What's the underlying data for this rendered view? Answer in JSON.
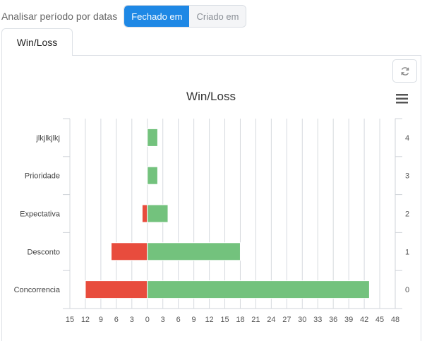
{
  "filter": {
    "label": "Analisar período por datas",
    "options": [
      "Fechado em",
      "Criado em"
    ],
    "selected": "Fechado em"
  },
  "tabs": [
    {
      "label": "Win/Loss",
      "active": true
    }
  ],
  "toolbar": {
    "refresh_icon": "refresh-icon",
    "menu_icon": "hamburger-menu-icon"
  },
  "colors": {
    "loss": "#e84c3d",
    "win": "#73c27d",
    "accent": "#1e88e5"
  },
  "chart_data": {
    "type": "bar",
    "orientation": "horizontal",
    "stacking": "diverging",
    "title": "Win/Loss",
    "categories": [
      "jlkjlkjlkj",
      "Prioridade",
      "Expectativa",
      "Desconto",
      "Concorrencia"
    ],
    "right_axis_labels": [
      "4",
      "3",
      "2",
      "1",
      "0"
    ],
    "series": [
      {
        "values": [
          0,
          0,
          -1,
          -7,
          -12
        ]
      },
      {
        "values": [
          2,
          2,
          4,
          18,
          43
        ]
      }
    ],
    "x_ticks": [
      "15",
      "12",
      "9",
      "6",
      "3",
      "0",
      "3",
      "6",
      "9",
      "12",
      "15",
      "18",
      "21",
      "24",
      "27",
      "30",
      "33",
      "36",
      "39",
      "42",
      "45",
      "48"
    ],
    "xlim": [
      -15,
      48
    ],
    "grid": true,
    "legend": "none"
  }
}
